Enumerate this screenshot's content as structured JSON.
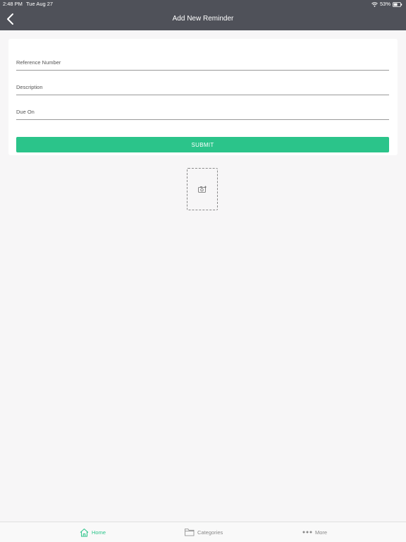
{
  "status_bar": {
    "time": "2:48 PM",
    "date": "Tue Aug 27",
    "battery": "53%"
  },
  "nav": {
    "title": "Add New Reminder"
  },
  "form": {
    "reference_placeholder": "Reference Number",
    "description_placeholder": "Description",
    "due_on_placeholder": "Due On",
    "submit_label": "SUBMIT"
  },
  "tabs": [
    {
      "label": "Home",
      "icon": "home-icon",
      "active": true
    },
    {
      "label": "Categories",
      "icon": "folder-icon",
      "active": false
    },
    {
      "label": "More",
      "icon": "more-dots-icon",
      "active": false
    }
  ],
  "colors": {
    "header": "#4f5159",
    "accent": "#2bc48a",
    "background": "#f7f6f7"
  }
}
